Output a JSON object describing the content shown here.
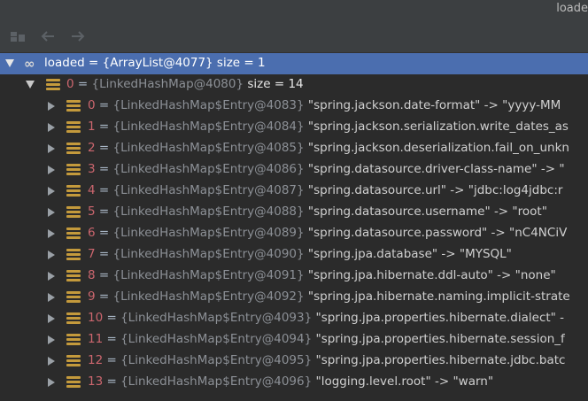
{
  "window": {
    "title": "loade"
  },
  "toolbar": {
    "buttons": [
      {
        "icon": "folder-tree-icon"
      },
      {
        "icon": "arrow-left-icon"
      },
      {
        "icon": "arrow-right-icon"
      }
    ]
  },
  "root": {
    "name": "loaded",
    "eq": " = ",
    "type": "{ArrayList@4077}",
    "extra": "  size = 1"
  },
  "child": {
    "name": "0",
    "eq": " = ",
    "type": "{LinkedHashMap@4080}",
    "extra": "  size = 14"
  },
  "entries": [
    {
      "index": "0",
      "type": "{LinkedHashMap$Entry@4083}",
      "value": " \"spring.jackson.date-format\" -> \"yyyy-MM"
    },
    {
      "index": "1",
      "type": "{LinkedHashMap$Entry@4084}",
      "value": " \"spring.jackson.serialization.write_dates_as"
    },
    {
      "index": "2",
      "type": "{LinkedHashMap$Entry@4085}",
      "value": " \"spring.jackson.deserialization.fail_on_unkn"
    },
    {
      "index": "3",
      "type": "{LinkedHashMap$Entry@4086}",
      "value": " \"spring.datasource.driver-class-name\" -> \""
    },
    {
      "index": "4",
      "type": "{LinkedHashMap$Entry@4087}",
      "value": " \"spring.datasource.url\" -> \"jdbc:log4jdbc:r"
    },
    {
      "index": "5",
      "type": "{LinkedHashMap$Entry@4088}",
      "value": " \"spring.datasource.username\" -> \"root\""
    },
    {
      "index": "6",
      "type": "{LinkedHashMap$Entry@4089}",
      "value": " \"spring.datasource.password\" -> \"nC4NCiV"
    },
    {
      "index": "7",
      "type": "{LinkedHashMap$Entry@4090}",
      "value": " \"spring.jpa.database\" -> \"MYSQL\""
    },
    {
      "index": "8",
      "type": "{LinkedHashMap$Entry@4091}",
      "value": " \"spring.jpa.hibernate.ddl-auto\" -> \"none\""
    },
    {
      "index": "9",
      "type": "{LinkedHashMap$Entry@4092}",
      "value": " \"spring.jpa.hibernate.naming.implicit-strate"
    },
    {
      "index": "10",
      "type": "{LinkedHashMap$Entry@4093}",
      "value": " \"spring.jpa.properties.hibernate.dialect\" -"
    },
    {
      "index": "11",
      "type": "{LinkedHashMap$Entry@4094}",
      "value": " \"spring.jpa.properties.hibernate.session_f"
    },
    {
      "index": "12",
      "type": "{LinkedHashMap$Entry@4095}",
      "value": " \"spring.jpa.properties.hibernate.jdbc.batc"
    },
    {
      "index": "13",
      "type": "{LinkedHashMap$Entry@4096}",
      "value": " \"logging.level.root\" -> \"warn\""
    }
  ],
  "entry_eq": " = "
}
